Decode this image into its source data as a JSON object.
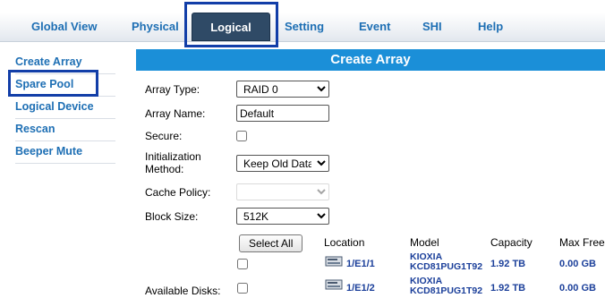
{
  "nav": {
    "tabs": [
      {
        "label": "Global View"
      },
      {
        "label": "Physical"
      },
      {
        "label": "Logical"
      },
      {
        "label": "Setting"
      },
      {
        "label": "Event"
      },
      {
        "label": "SHI"
      },
      {
        "label": "Help"
      }
    ],
    "active_tab": "Logical"
  },
  "sidebar": {
    "items": [
      {
        "label": "Create Array"
      },
      {
        "label": "Spare Pool"
      },
      {
        "label": "Logical Device"
      },
      {
        "label": "Rescan"
      },
      {
        "label": "Beeper Mute"
      }
    ]
  },
  "panel": {
    "title": "Create Array",
    "array_type_label": "Array Type:",
    "array_type_value": "RAID 0",
    "array_name_label": "Array Name:",
    "array_name_value": "Default",
    "secure_label": "Secure:",
    "init_label_1": "Initialization",
    "init_label_2": "Method:",
    "init_value": "Keep Old Data",
    "cache_label": "Cache Policy:",
    "block_label": "Block Size:",
    "block_value": "512K",
    "available_disks_label": "Available Disks:",
    "select_all_label": "Select All",
    "columns": {
      "location": "Location",
      "model": "Model",
      "capacity": "Capacity",
      "max_free": "Max Free"
    },
    "disks": [
      {
        "location": "1/E1/1",
        "model_1": "KIOXIA",
        "model_2": "KCD81PUG1T92",
        "capacity": "1.92 TB",
        "max_free": "0.00 GB"
      },
      {
        "location": "1/E1/2",
        "model_1": "KIOXIA",
        "model_2": "KCD81PUG1T92",
        "capacity": "1.92 TB",
        "max_free": "0.00 GB"
      }
    ]
  },
  "colors": {
    "accent": "#1b8fd8",
    "link": "#1e6fb4",
    "highlight": "#123ea8",
    "active_tab": "#2f4a66"
  }
}
